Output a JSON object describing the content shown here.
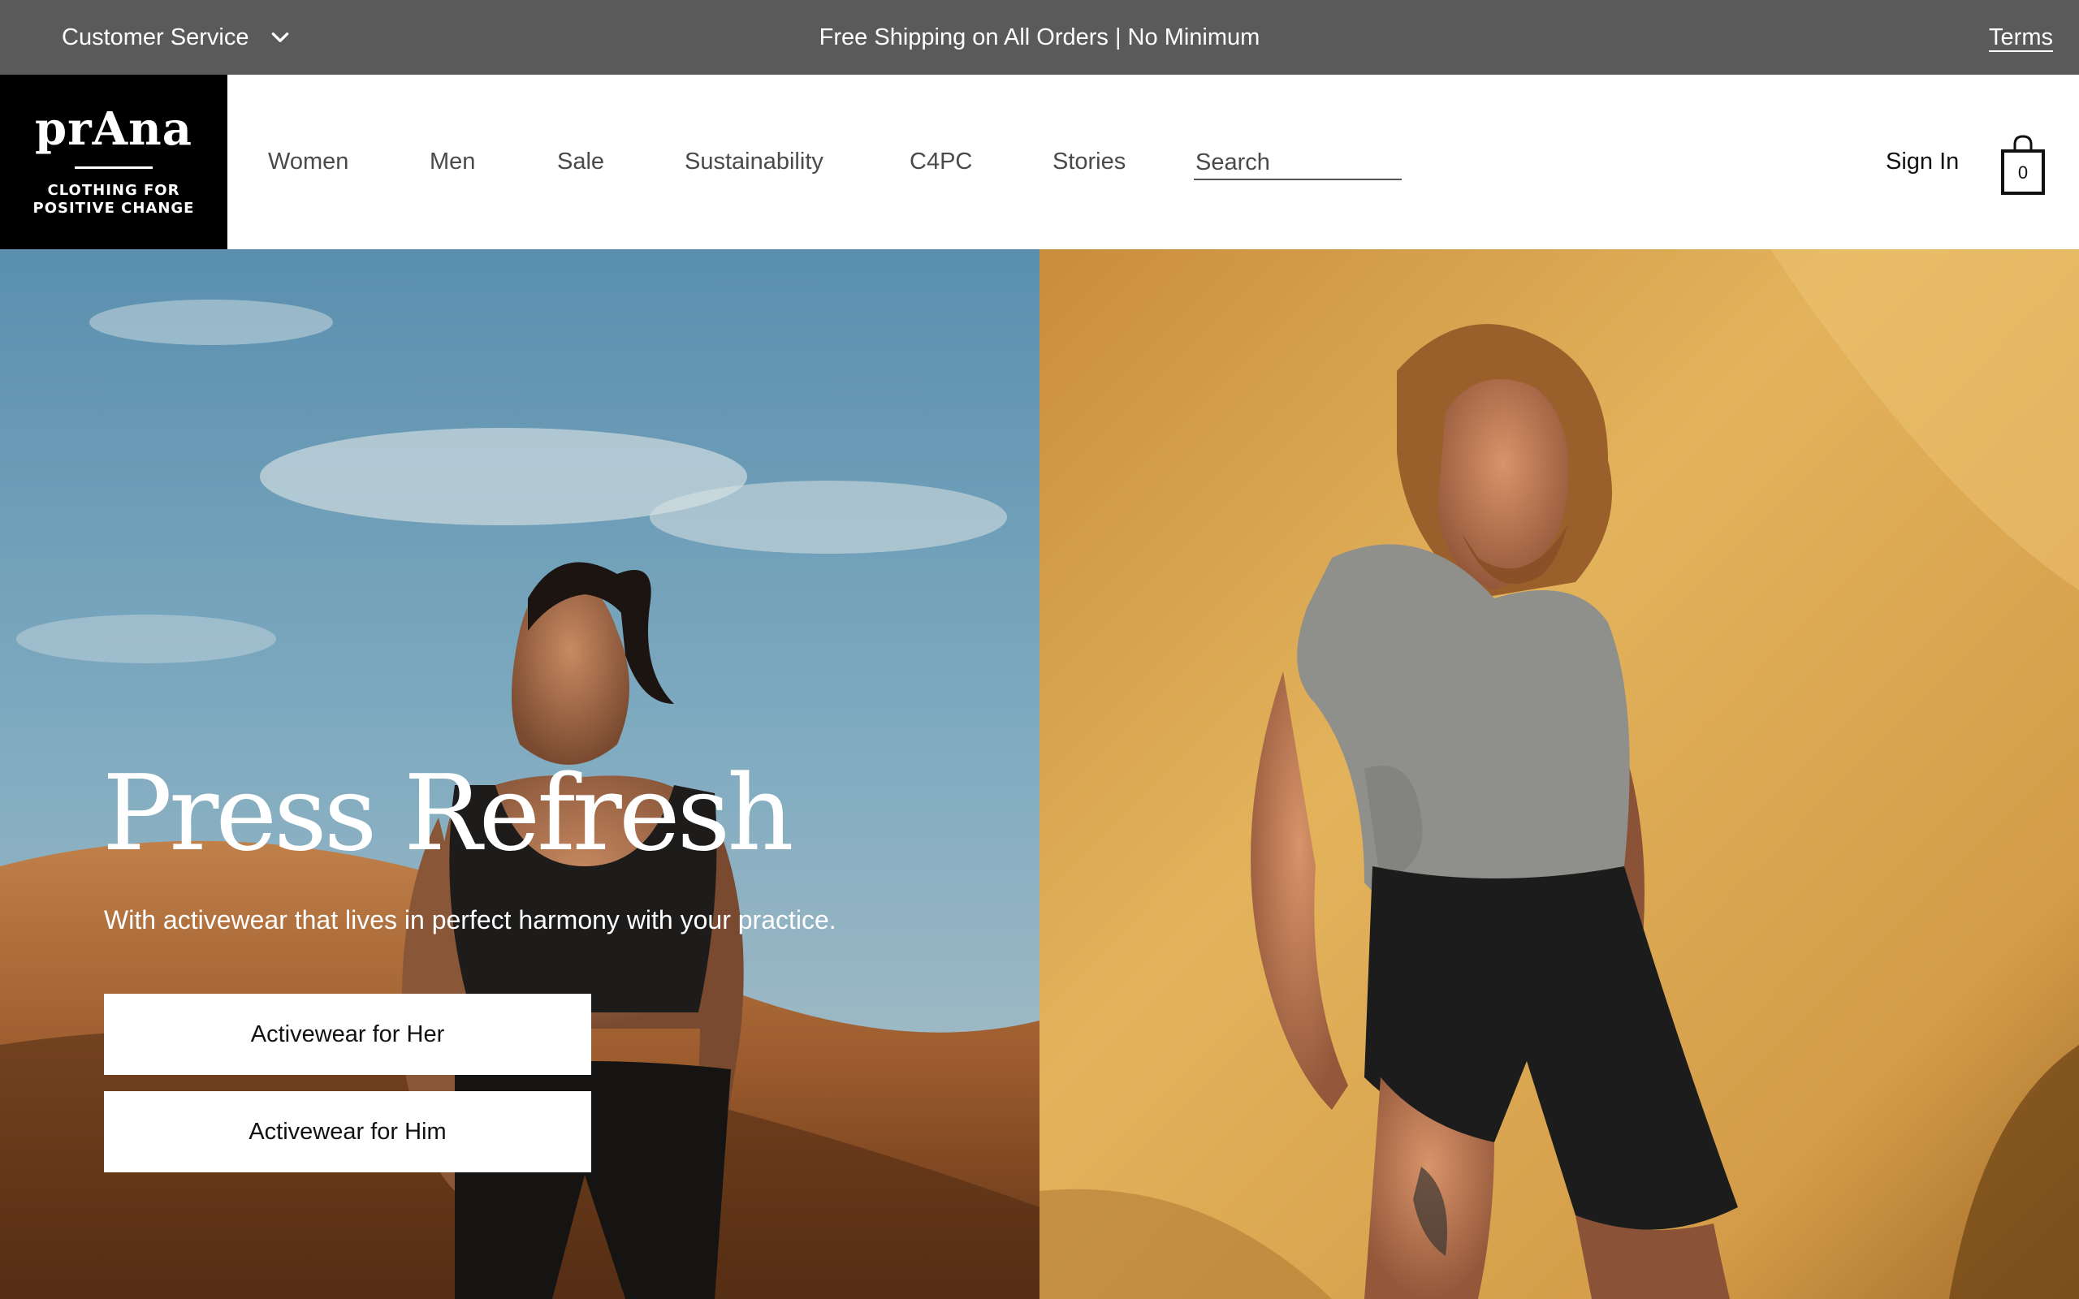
{
  "topbar": {
    "customer_service": "Customer Service",
    "promo": "Free Shipping on All Orders | No Minimum",
    "terms": "Terms"
  },
  "header": {
    "logo": {
      "wordmark": "prAna",
      "tagline_line1": "CLOTHING FOR",
      "tagline_line2": "POSITIVE CHANGE"
    },
    "nav": [
      "Women",
      "Men",
      "Sale",
      "Sustainability",
      "C4PC",
      "Stories"
    ],
    "search_placeholder": "Search",
    "sign_in": "Sign In",
    "cart_count": "0"
  },
  "hero": {
    "title": "Press Refresh",
    "subtitle": "With activewear that lives in perfect harmony with your practice.",
    "cta_primary": "Activewear for Her",
    "cta_secondary": "Activewear for Him"
  },
  "colors": {
    "topbar_bg": "#5a5a5a",
    "logo_bg": "#000000",
    "header_bg": "#ffffff",
    "cta_bg": "#ffffff"
  },
  "icons": {
    "dropdown": "chevron-down-icon",
    "cart": "shopping-bag-icon"
  }
}
